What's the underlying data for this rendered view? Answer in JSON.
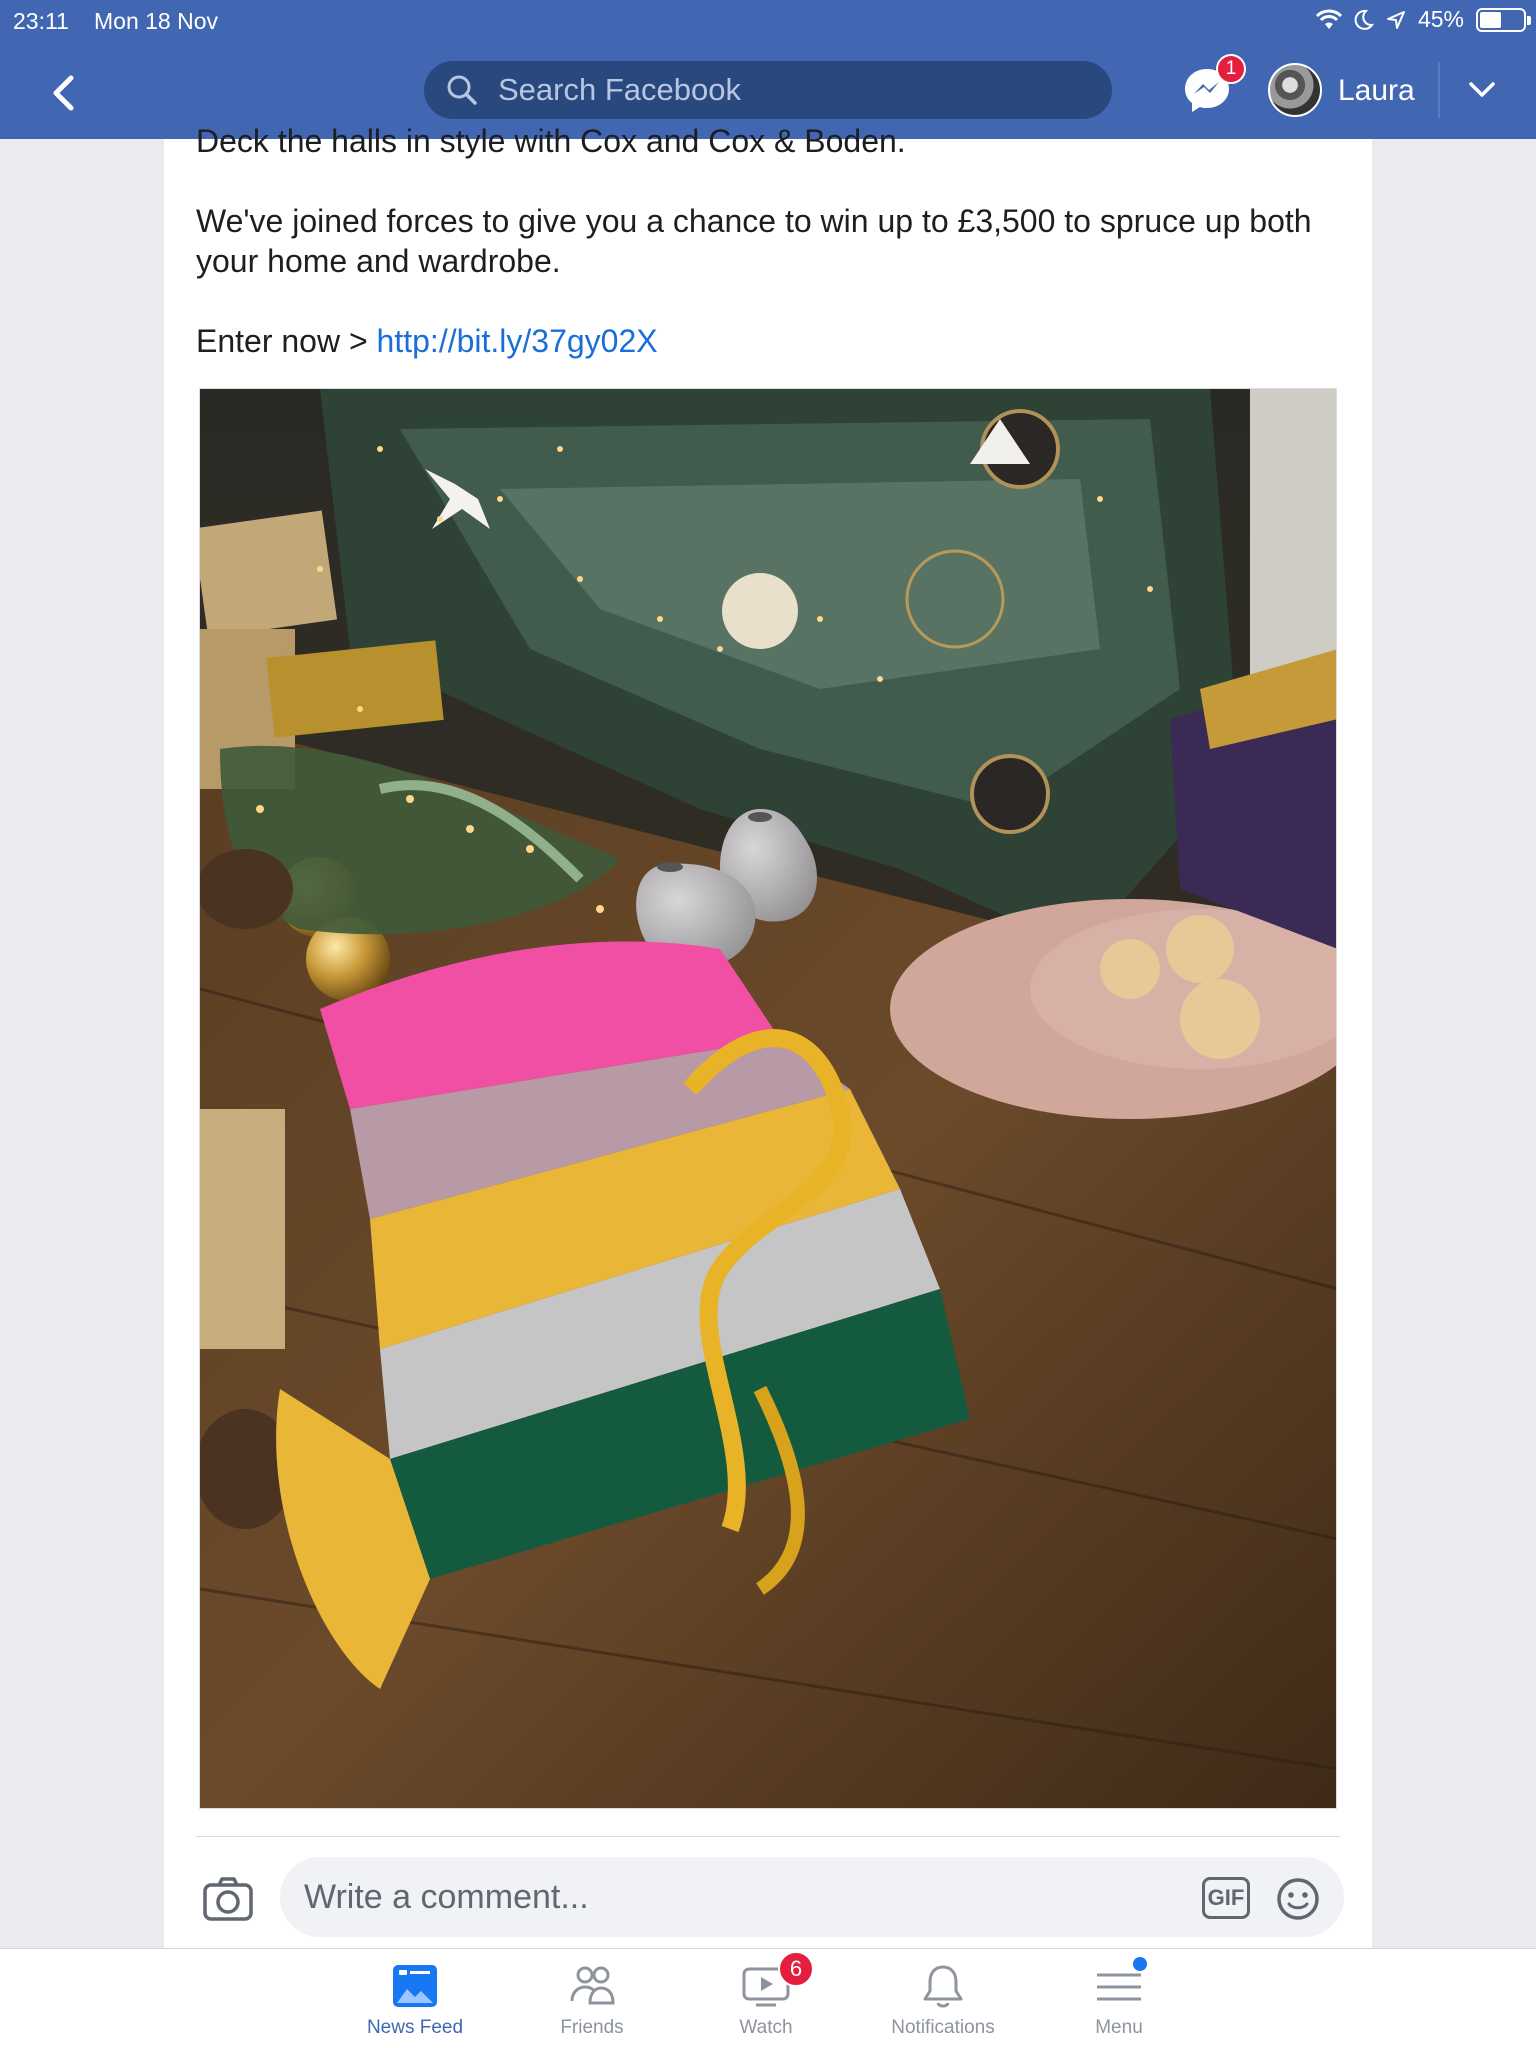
{
  "status_bar": {
    "time": "23:11",
    "date": "Mon 18 Nov",
    "battery": "45%",
    "battery_level": 0.45
  },
  "header": {
    "search_placeholder": "Search Facebook",
    "messenger_badge": "1",
    "user_name": "Laura",
    "colors": {
      "bar": "#4267b2",
      "search_bg": "#29487d",
      "badge": "#e41e3f"
    }
  },
  "post": {
    "line_1": "Deck the halls in style with Cox and Cox & Boden.",
    "line_2": "We've joined forces to give you a chance to win up to £3,500 to spruce up both your home and wardrobe.",
    "line_3_prefix": "Enter now > ",
    "line_3_link": "http://bit.ly/37gy02X"
  },
  "comment": {
    "placeholder": "Write a comment...",
    "gif_label": "GIF"
  },
  "tabs": [
    {
      "label": "News Feed",
      "icon": "news-feed-icon",
      "active": true
    },
    {
      "label": "Friends",
      "icon": "friends-icon"
    },
    {
      "label": "Watch",
      "icon": "watch-icon",
      "badge": "6"
    },
    {
      "label": "Notifications",
      "icon": "bell-icon"
    },
    {
      "label": "Menu",
      "icon": "menu-icon"
    }
  ]
}
